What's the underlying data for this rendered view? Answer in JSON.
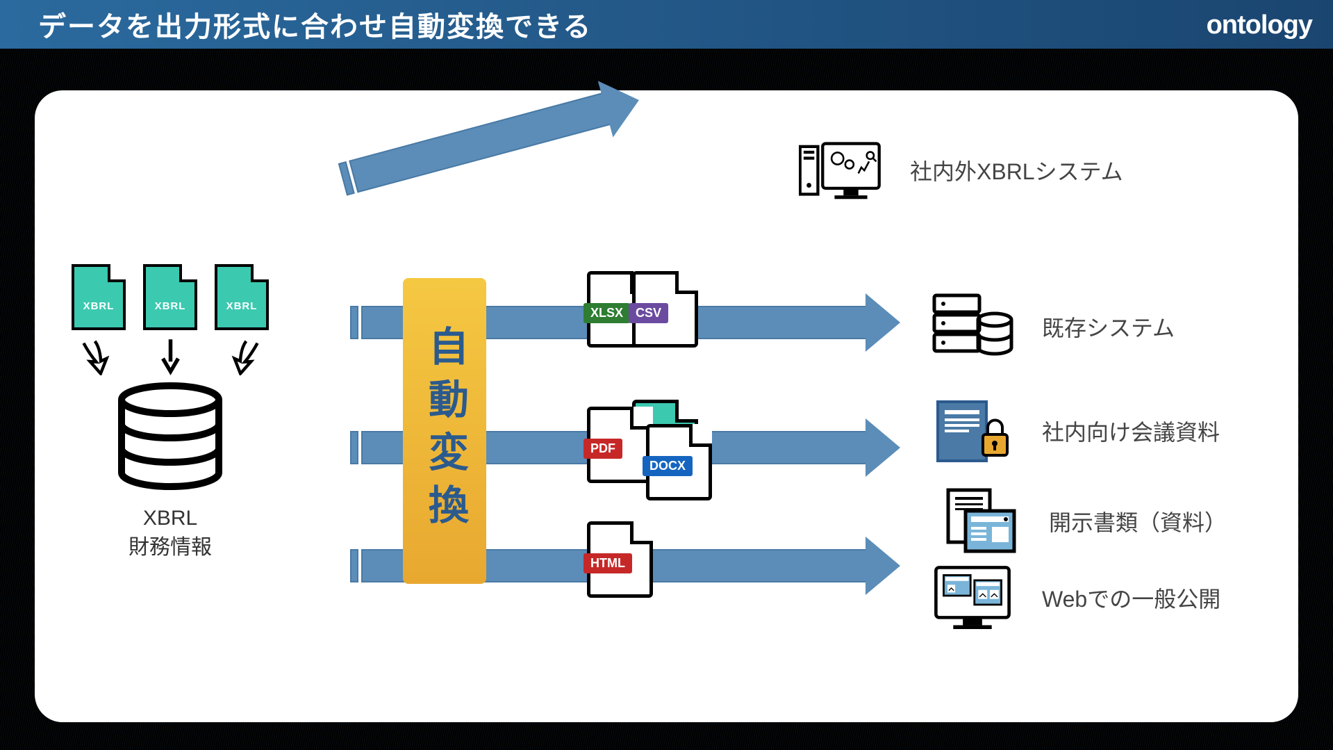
{
  "header": {
    "title": "データを出力形式に合わせ自動変換できる",
    "brand": "ontology"
  },
  "source": {
    "file_label": "XBRL",
    "caption_line1": "XBRL",
    "caption_line2": "財務情報"
  },
  "transform": {
    "label": "自動変換"
  },
  "file_formats": {
    "xlsx": "XLSX",
    "csv": "CSV",
    "pdf": "PDF",
    "xbrl": "XBRL",
    "docx": "DOCX",
    "html": "HTML"
  },
  "outputs": {
    "system_xbrl": "社内外XBRLシステム",
    "existing": "既存システム",
    "meeting": "社内向け会議資料",
    "disclosure": "開示書類（資料）",
    "web": "Webでの一般公開"
  }
}
